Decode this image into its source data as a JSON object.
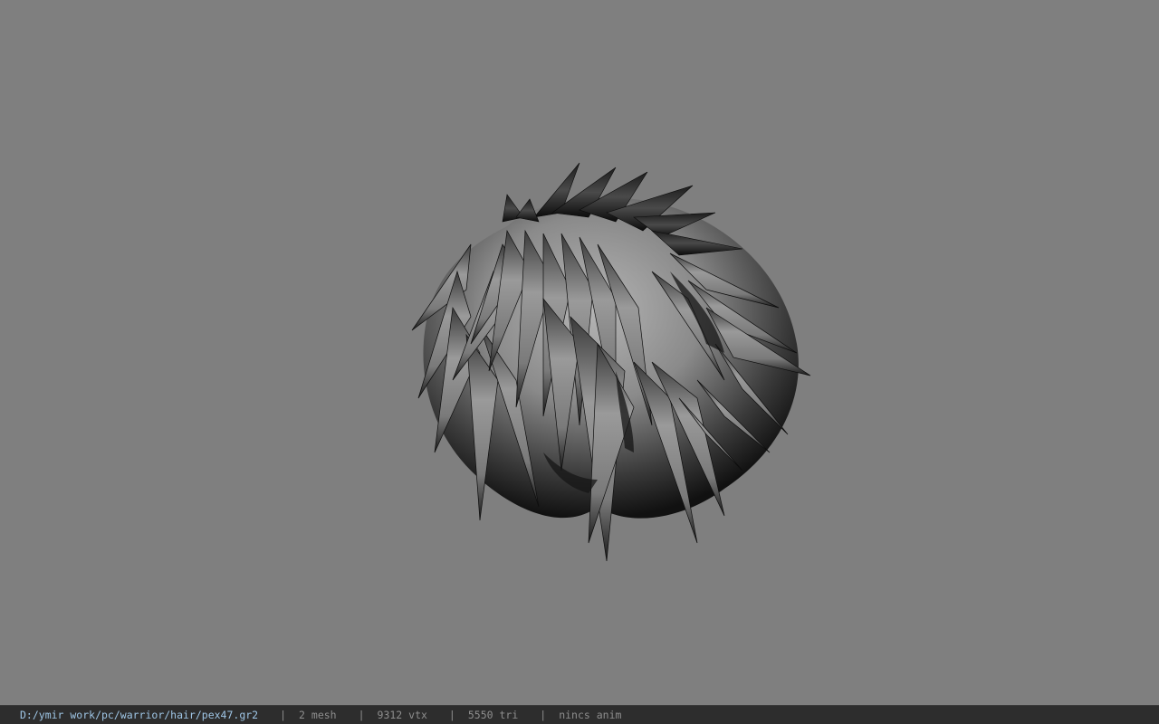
{
  "viewport": {
    "background_color": "#7f7f7f",
    "model": "hair-mesh"
  },
  "status_bar": {
    "file_path": "D:/ymir work/pc/warrior/hair/pex47.gr2",
    "separator": "|",
    "mesh_count": "2 mesh",
    "vertex_count": "9312 vtx",
    "triangle_count": "5550 tri",
    "anim_status": "nincs anim",
    "path_color": "#9fc6e6",
    "text_color": "#8e8e8e"
  }
}
